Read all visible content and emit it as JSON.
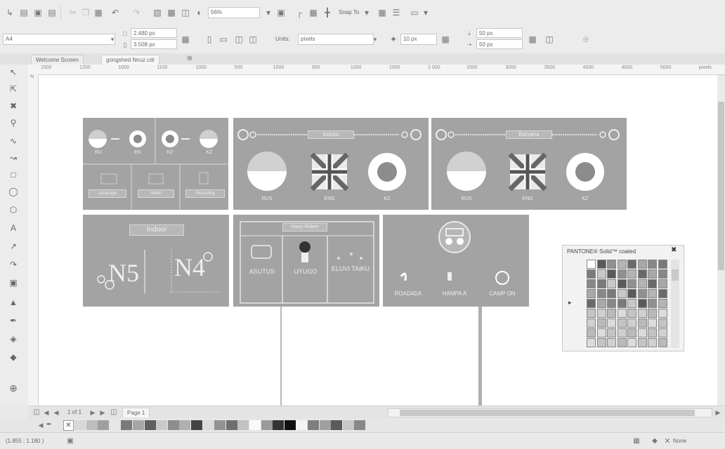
{
  "toolbar": {
    "zoom_value": "56%",
    "snap_to_label": "Snap To",
    "new_icon": "new-document-icon"
  },
  "property_bar": {
    "object_select_value": "A4",
    "width_value": "2.480 px",
    "height_value": "3.508 px",
    "units_label": "Units:",
    "units_value": "pixels",
    "nudge_value": "10 px",
    "dup_x_value": "50 px",
    "dup_y_value": "50 px"
  },
  "tabs": [
    {
      "label": "Welcome Screen"
    },
    {
      "label": "gongshed Nnuz.cdr"
    }
  ],
  "ruler": {
    "h_ticks": [
      "1500",
      "1200",
      "1000",
      "1100",
      "1000",
      "500",
      "1000",
      "500",
      "1000",
      "1500",
      "2 000",
      "2500",
      "3000",
      "3500",
      "4000",
      "4500",
      "5000",
      "pixels"
    ],
    "v_label": "N"
  },
  "canvas": {
    "panel_indsku": {
      "caption": "Indsku",
      "labels": [
        "RUS",
        "ENG",
        "KZ"
      ]
    },
    "panel_batyana": {
      "caption": "Batyana",
      "labels": [
        "RUS",
        "ENG",
        "KZ"
      ]
    },
    "panel_small": {
      "labels": [
        "RU",
        "EN",
        "KZ",
        "KZ"
      ],
      "buttons": [
        "Language",
        "Hlodo",
        "Recording"
      ]
    },
    "panel_indoor": {
      "caption": "Indoor",
      "left_text": "N5",
      "right_text": "N4"
    },
    "panel_map": {
      "caption": "Hawy Robee",
      "labels": [
        "ASUTUS",
        "UYUGO",
        "ELUVI TAIKU"
      ]
    },
    "panel_services": {
      "labels": [
        "ROAD4DA",
        "HAMPA A",
        "CAMP ON"
      ]
    }
  },
  "pantone": {
    "title": "PANTONE® Solid™ coated",
    "close": "✖"
  },
  "pagebar": {
    "page_count": "1 of 1",
    "page_tab": "Page 1"
  },
  "status": {
    "coords": "(1.855 ; 1.180 )",
    "fill_label": "None"
  }
}
